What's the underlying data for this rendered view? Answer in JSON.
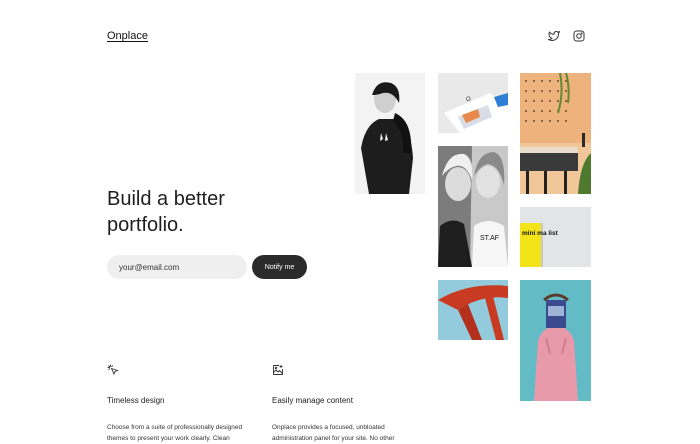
{
  "header": {
    "brand": "Onplace",
    "social": [
      {
        "icon": "twitter-icon"
      },
      {
        "icon": "instagram-icon"
      }
    ]
  },
  "hero": {
    "title": "Build a better portfolio.",
    "email_placeholder": "your@email.com",
    "notify_label": "Notify me"
  },
  "features": [
    {
      "icon": "cursor-click-icon",
      "title": "Timeless design",
      "text": "Choose from a suite of professionally designed themes to present your work clearly. Clean"
    },
    {
      "icon": "image-add-icon",
      "title": "Easily manage content",
      "text": "Onplace provides a focused, unbloated administration panel for your site. No other"
    }
  ],
  "gallery": {
    "photo_2_text": "O",
    "photo_3_text": "ST.AF",
    "photo_5_text": "mini ma list"
  },
  "colors": {
    "button_dark": "#2b2b2b",
    "input_bg": "#efefef",
    "accent_red": "#c93a22",
    "teal": "#63bcc5",
    "pink": "#e89aab",
    "yellow": "#f2e418"
  }
}
